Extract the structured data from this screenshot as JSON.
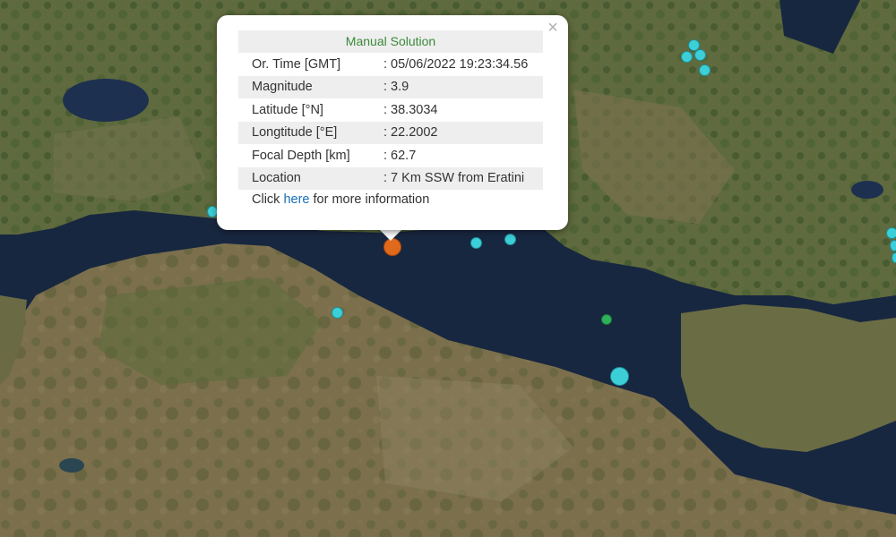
{
  "map": {
    "markers": [
      {
        "id": "selected-quake",
        "color": "#e06a1c"
      },
      {
        "id": "quake",
        "color": "#3ccfd8"
      },
      {
        "id": "quake-green",
        "color": "#2fb05a"
      }
    ]
  },
  "popup": {
    "title": "Manual Solution",
    "title_color": "#3a8a38",
    "close_symbol": "×",
    "rows": [
      {
        "label": "Or. Time [GMT]",
        "value": ": 05/06/2022 19:23:34.56"
      },
      {
        "label": "Magnitude",
        "value": ": 3.9"
      },
      {
        "label": "Latitude [°N]",
        "value": ": 38.3034"
      },
      {
        "label": "Longtitude [°E]",
        "value": ": 22.2002"
      },
      {
        "label": "Focal Depth [km]",
        "value": ": 62.7"
      },
      {
        "label": "Location",
        "value": ": 7 Km SSW from Eratini"
      }
    ],
    "more_prefix": "Click ",
    "more_link": "here",
    "more_suffix": " for more information",
    "link_color": "#1a6fb5"
  }
}
